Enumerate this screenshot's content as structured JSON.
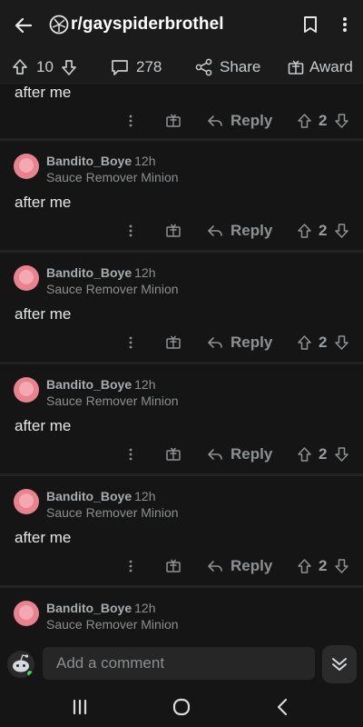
{
  "header": {
    "subreddit": "r/gayspiderbrothel",
    "icons": [
      "back-arrow-icon",
      "subreddit-icon",
      "bookmark-icon",
      "more-vert-icon"
    ]
  },
  "post_bar": {
    "vote_count": "10",
    "comment_count": "278",
    "share_label": "Share",
    "award_label": "Award"
  },
  "partial_comment": {
    "body": "after me",
    "score": "2",
    "reply_label": "Reply"
  },
  "comments": [
    {
      "author": "Bandito_Boye",
      "time": "12h",
      "flair": "Sauce Remover Minion",
      "body": "after me",
      "score": "2",
      "reply_label": "Reply"
    },
    {
      "author": "Bandito_Boye",
      "time": "12h",
      "flair": "Sauce Remover Minion",
      "body": "after me",
      "score": "2",
      "reply_label": "Reply"
    },
    {
      "author": "Bandito_Boye",
      "time": "12h",
      "flair": "Sauce Remover Minion",
      "body": "after me",
      "score": "2",
      "reply_label": "Reply"
    },
    {
      "author": "Bandito_Boye",
      "time": "12h",
      "flair": "Sauce Remover Minion",
      "body": "after me",
      "score": "2",
      "reply_label": "Reply"
    },
    {
      "author": "Bandito_Boye",
      "time": "12h",
      "flair": "Sauce Remover Minion"
    }
  ],
  "composer": {
    "placeholder": "Add a comment"
  },
  "colors": {
    "background": "#151515",
    "text": "#d7dadc",
    "muted": "#8b8e90",
    "avatar": "#e8828e",
    "online": "#46d160"
  }
}
